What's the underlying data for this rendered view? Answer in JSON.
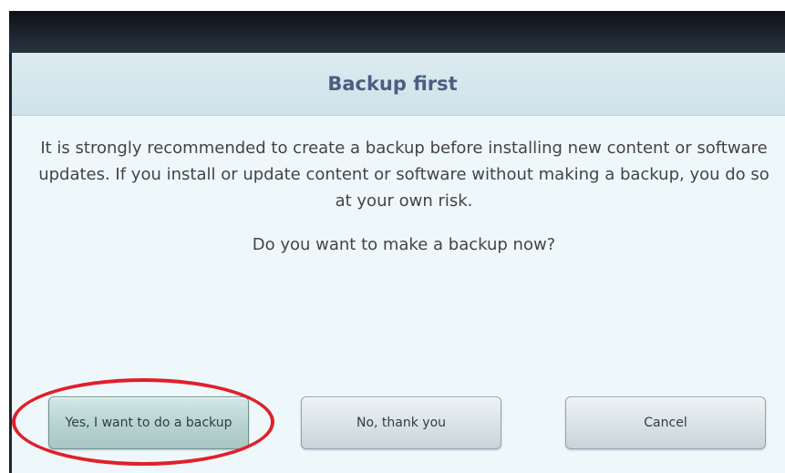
{
  "dialog": {
    "title": "Backup first",
    "message": "It is strongly recommended to create a backup before installing new content or software updates. If you install or update content or software without making a backup, you do so at your own risk.",
    "question": "Do you want to make a backup now?"
  },
  "buttons": {
    "yes": "Yes, I want to do a backup",
    "no": "No, thank you",
    "cancel": "Cancel"
  },
  "annotation": {
    "highlight_color": "#e0202a",
    "highlight_target": "yes"
  }
}
